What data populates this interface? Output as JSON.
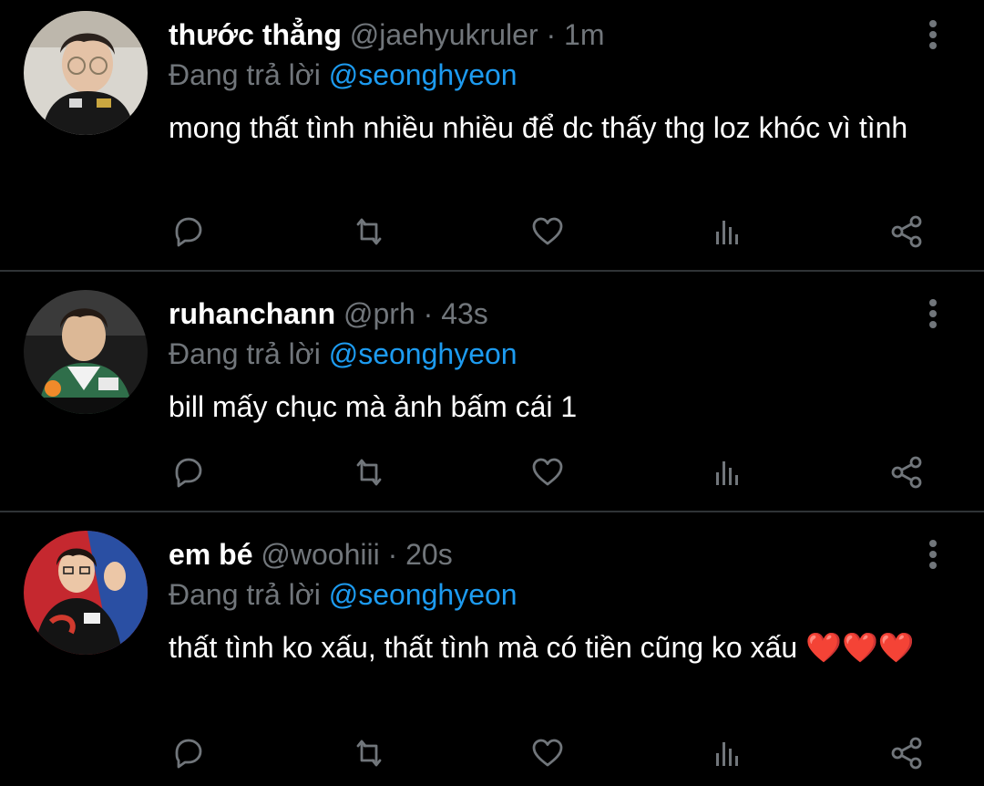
{
  "colors": {
    "background": "#000000",
    "name": "#ffffff",
    "muted": "#71767b",
    "mention": "#1d9bf0",
    "divider": "#2f3336"
  },
  "icons": [
    "reply-icon",
    "retweet-icon",
    "like-icon",
    "analytics-icon",
    "share-icon",
    "more-icon"
  ],
  "tweets": [
    {
      "display_name": "thước thẳng",
      "handle": "@jaehyukruler",
      "separator": "·",
      "time": "1m",
      "reply_prefix": "Đang trả lời",
      "reply_to": "@seonghyeon",
      "text": "mong thất tình nhiều nhiều để dc thấy thg loz khóc vì tình"
    },
    {
      "display_name": "ruhanchann",
      "handle": "@prh",
      "separator": "·",
      "time": "43s",
      "reply_prefix": "Đang trả lời",
      "reply_to": "@seonghyeon",
      "text": "bill mấy chục mà ảnh bấm cái 1"
    },
    {
      "display_name": "em bé",
      "handle": "@woohiii",
      "separator": "·",
      "time": "20s",
      "reply_prefix": "Đang trả lời",
      "reply_to": "@seonghyeon",
      "text": "thất tình ko xấu, thất tình mà có tiền cũng ko xấu",
      "emoji": "❤️❤️❤️"
    }
  ]
}
